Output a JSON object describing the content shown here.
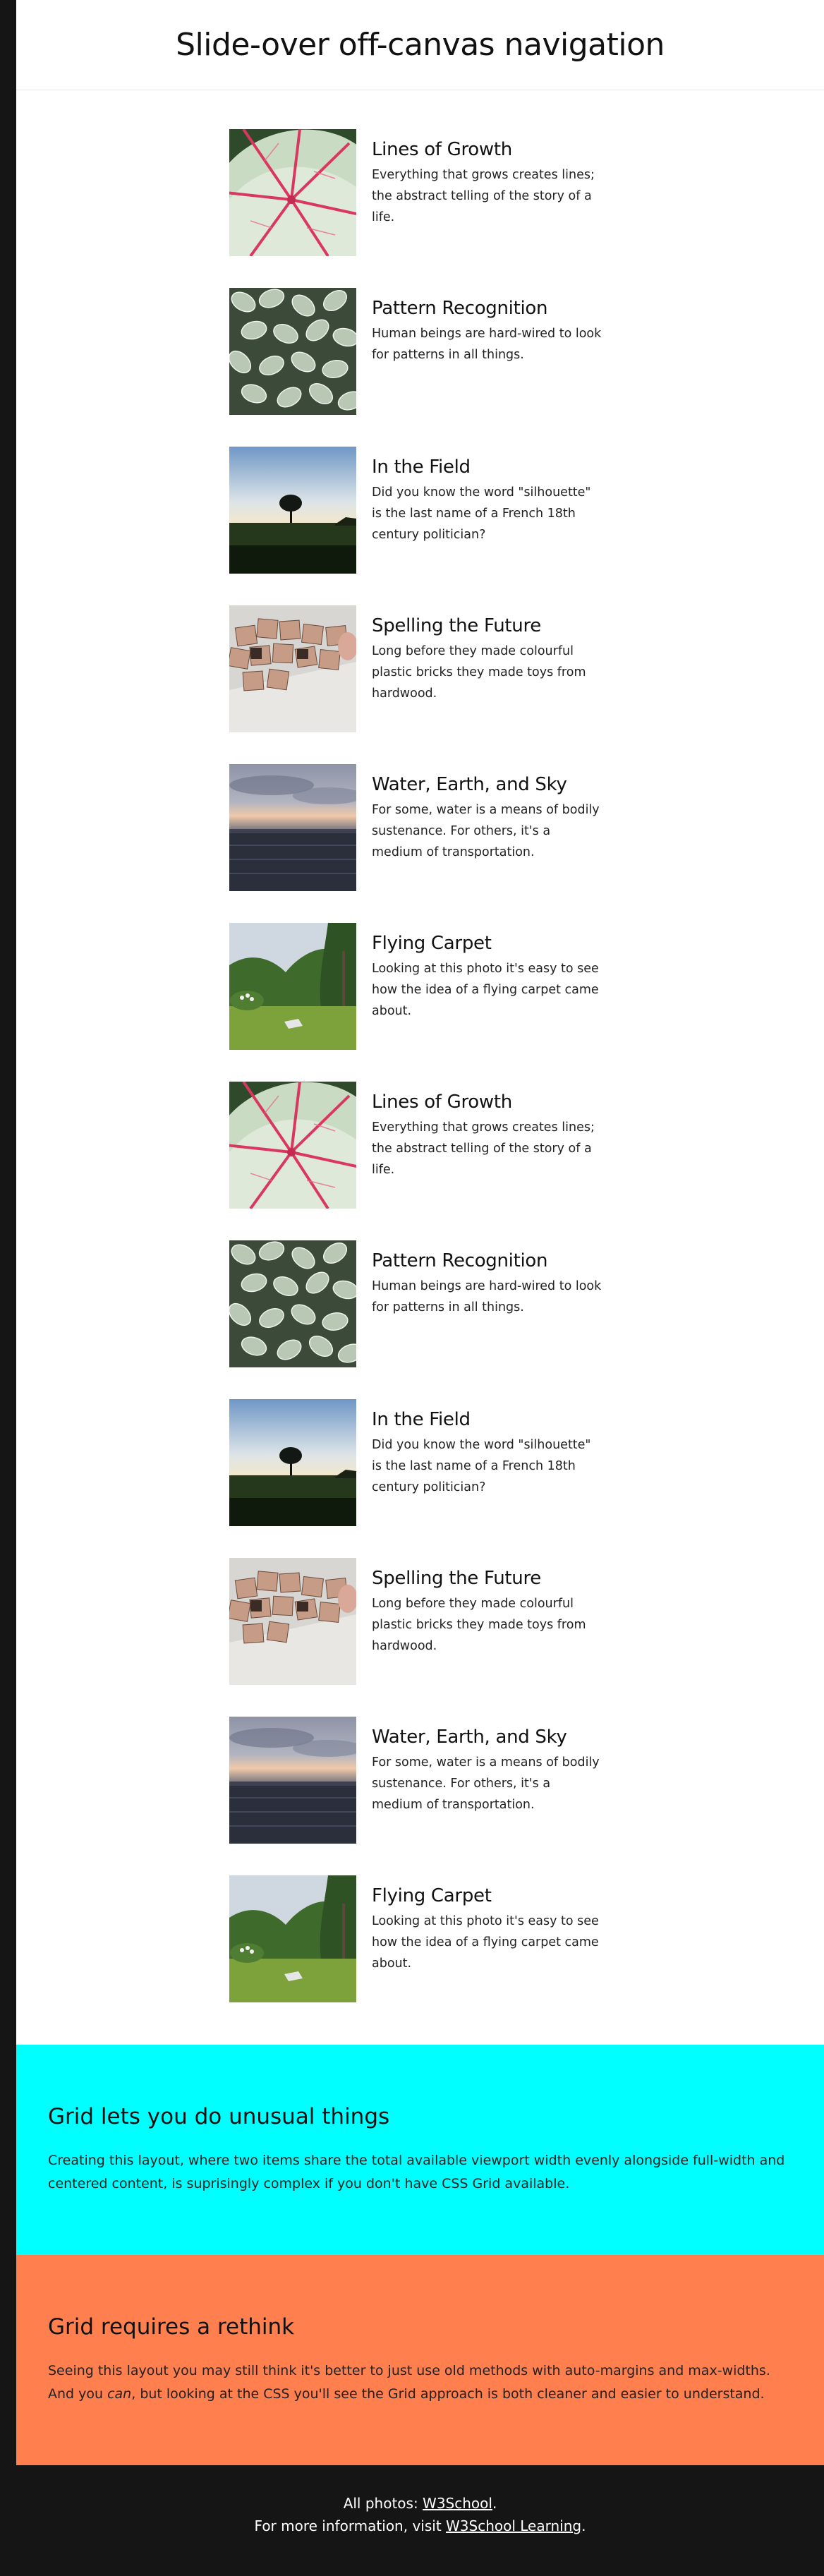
{
  "header": {
    "title": "Slide-over off-canvas navigation"
  },
  "items": [
    {
      "title": "Lines of Growth",
      "body": "Everything that grows creates lines; the abstract telling of the story of a life.",
      "image": "leaf-photo"
    },
    {
      "title": "Pattern Recognition",
      "body": "Human beings are hard-wired to look for patterns in all things.",
      "image": "pattern-leaves-photo"
    },
    {
      "title": "In the Field",
      "body": "Did you know the word \"silhouette\" is the last name of a French 18th century politician?",
      "image": "field-tree-photo"
    },
    {
      "title": "Spelling the Future",
      "body": "Long before they made colourful plastic bricks they made toys from hardwood.",
      "image": "wooden-blocks-photo"
    },
    {
      "title": "Water, Earth, and Sky",
      "body": "For some, water is a means of bodily sustenance. For others, it's a medium of transportation.",
      "image": "lake-sky-photo"
    },
    {
      "title": "Flying Carpet",
      "body": "Looking at this photo it's easy to see how the idea of a flying carpet came about.",
      "image": "garden-carpet-photo"
    },
    {
      "title": "Lines of Growth",
      "body": "Everything that grows creates lines; the abstract telling of the story of a life.",
      "image": "leaf-photo"
    },
    {
      "title": "Pattern Recognition",
      "body": "Human beings are hard-wired to look for patterns in all things.",
      "image": "pattern-leaves-photo"
    },
    {
      "title": "In the Field",
      "body": "Did you know the word \"silhouette\" is the last name of a French 18th century politician?",
      "image": "field-tree-photo"
    },
    {
      "title": "Spelling the Future",
      "body": "Long before they made colourful plastic bricks they made toys from hardwood.",
      "image": "wooden-blocks-photo"
    },
    {
      "title": "Water, Earth, and Sky",
      "body": "For some, water is a means of bodily sustenance. For others, it's a medium of transportation.",
      "image": "lake-sky-photo"
    },
    {
      "title": "Flying Carpet",
      "body": "Looking at this photo it's easy to see how the idea of a flying carpet came about.",
      "image": "garden-carpet-photo"
    }
  ],
  "grid_unusual": {
    "title": "Grid lets you do unusual things",
    "body": "Creating this layout, where two items share the total available viewport width evenly alongside full-width and centered content, is suprisingly complex if you don't have CSS Grid available.",
    "bg": "#00ffff"
  },
  "grid_rethink": {
    "title": "Grid requires a rethink",
    "body_before": "Seeing this layout you may still think it's better to just use old methods with auto-margins and max-widths. And you ",
    "body_em": "can",
    "body_after": ", but looking at the CSS you'll see the Grid approach is both cleaner and easier to understand.",
    "bg": "#ff7f4f"
  },
  "footer": {
    "photos_prefix": "All photos: ",
    "photos_link": "W3School",
    "photos_suffix": ".",
    "info_prefix": "For more information, visit ",
    "info_link": "W3School Learning",
    "info_suffix": "."
  }
}
